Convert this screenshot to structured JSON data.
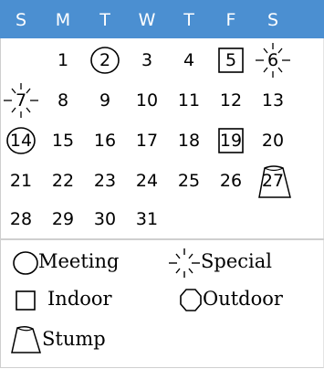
{
  "header": {
    "weekdays": [
      "S",
      "M",
      "T",
      "W",
      "T",
      "F",
      "S"
    ],
    "background": "#4b8fd1"
  },
  "calendar": {
    "weeks": [
      [
        {
          "d": ""
        },
        {
          "d": "1"
        },
        {
          "d": "2",
          "mark": "circle"
        },
        {
          "d": "3"
        },
        {
          "d": "4"
        },
        {
          "d": "5",
          "mark": "square"
        },
        {
          "d": "6",
          "mark": "special"
        }
      ],
      [
        {
          "d": "7",
          "mark": "special"
        },
        {
          "d": "8"
        },
        {
          "d": "9"
        },
        {
          "d": "10"
        },
        {
          "d": "11"
        },
        {
          "d": "12"
        },
        {
          "d": "13"
        }
      ],
      [
        {
          "d": "14",
          "mark": "circle"
        },
        {
          "d": "15"
        },
        {
          "d": "16"
        },
        {
          "d": "17"
        },
        {
          "d": "18"
        },
        {
          "d": "19",
          "mark": "square"
        },
        {
          "d": "20"
        }
      ],
      [
        {
          "d": "21"
        },
        {
          "d": "22"
        },
        {
          "d": "23"
        },
        {
          "d": "24"
        },
        {
          "d": "25"
        },
        {
          "d": "26"
        },
        {
          "d": "27",
          "mark": "stump"
        }
      ],
      [
        {
          "d": "28"
        },
        {
          "d": "29"
        },
        {
          "d": "30"
        },
        {
          "d": "31"
        },
        {
          "d": ""
        },
        {
          "d": ""
        },
        {
          "d": ""
        }
      ]
    ]
  },
  "legend": {
    "meeting": "Meeting",
    "special": "Special",
    "indoor": "Indoor",
    "outdoor": "Outdoor",
    "stump": "Stump"
  }
}
